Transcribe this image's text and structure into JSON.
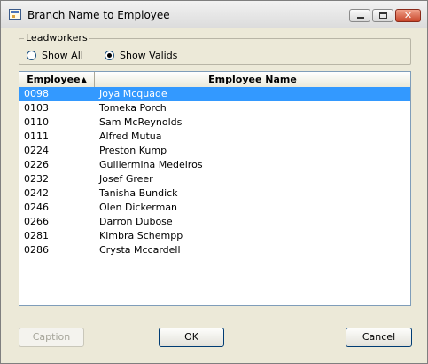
{
  "window": {
    "title": "Branch Name to Employee"
  },
  "group": {
    "legend": "Leadworkers",
    "radios": [
      {
        "label": "Show All",
        "checked": false
      },
      {
        "label": "Show Valids",
        "checked": true
      }
    ]
  },
  "list": {
    "headers": {
      "employee": "Employee",
      "employee_name": "Employee Name"
    },
    "sort_indicator": "▲",
    "selected_index": 0,
    "rows": [
      {
        "employee": "0098",
        "name": "Joya Mcquade"
      },
      {
        "employee": "0103",
        "name": "Tomeka Porch"
      },
      {
        "employee": "0110",
        "name": "Sam McReynolds"
      },
      {
        "employee": "0111",
        "name": "Alfred Mutua"
      },
      {
        "employee": "0224",
        "name": "Preston Kump"
      },
      {
        "employee": "0226",
        "name": "Guillermina Medeiros"
      },
      {
        "employee": "0232",
        "name": "Josef Greer"
      },
      {
        "employee": "0242",
        "name": "Tanisha Bundick"
      },
      {
        "employee": "0246",
        "name": "Olen Dickerman"
      },
      {
        "employee": "0266",
        "name": "Darron Dubose"
      },
      {
        "employee": "0281",
        "name": "Kimbra Schempp"
      },
      {
        "employee": "0286",
        "name": "Crysta Mccardell"
      }
    ]
  },
  "buttons": {
    "caption": "Caption",
    "ok": "OK",
    "cancel": "Cancel"
  },
  "colors": {
    "selection": "#3399ff",
    "window_bg": "#ece9d8"
  }
}
